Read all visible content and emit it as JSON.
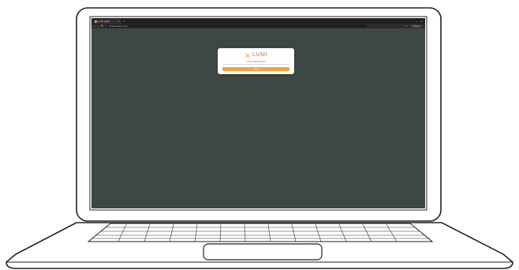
{
  "browser": {
    "tab_title": "LUMI AGM",
    "tab_close": "×",
    "new_tab": "+",
    "window_controls": [
      "–",
      "×"
    ],
    "nav": {
      "back": "←",
      "forward": "→",
      "reload": "↻"
    },
    "url": "web.lumiagm.com",
    "star": "☆",
    "profile_label": "Guest"
  },
  "login_card": {
    "brand_text": "LUMI",
    "meeting_id_label": "Lumi Meeting ID",
    "join_button_label": "JOIN"
  },
  "colors": {
    "screen_background": "#3d4743",
    "brand": "#a8753b",
    "button": "#f0a53d"
  }
}
